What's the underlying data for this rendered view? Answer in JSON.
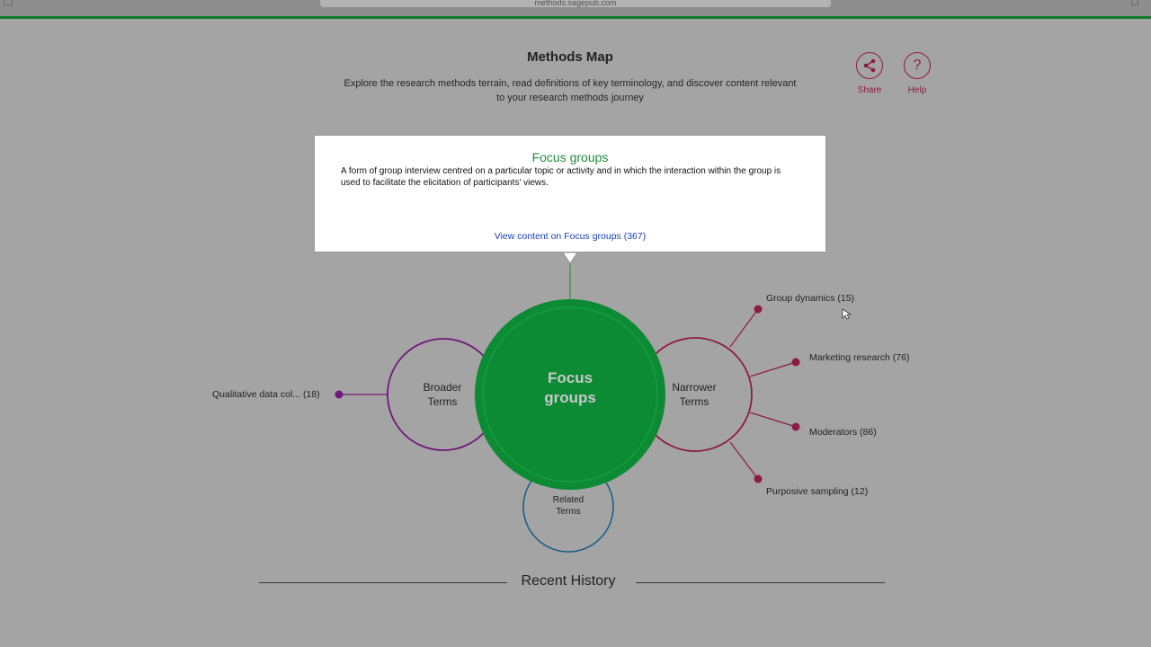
{
  "browser": {
    "url": "methods.sagepub.com"
  },
  "header": {
    "title": "Methods Map",
    "subtitle": "Explore the research methods terrain, read definitions of key terminology, and discover content relevant to your research methods journey",
    "share_label": "Share",
    "help_label": "Help",
    "share_icon": "share-icon",
    "help_icon": "question-mark-icon",
    "help_glyph": "?"
  },
  "definition": {
    "term": "Focus groups",
    "text": "A form of group interview centred on a particular topic or activity and in which the interaction within the group is used to facilitate the elicitation of participants' views.",
    "link": "View content on Focus groups (367)"
  },
  "map": {
    "center_line1": "Focus",
    "center_line2": "groups",
    "broader_line1": "Broader",
    "broader_line2": "Terms",
    "narrower_line1": "Narrower",
    "narrower_line2": "Terms",
    "related_line1": "Related",
    "related_line2": "Terms",
    "broader_terms": [
      "Qualitative data col... (18)"
    ],
    "narrower_terms": [
      "Group dynamics (15)",
      "Marketing research (76)",
      "Moderators (86)",
      "Purposive sampling (12)"
    ]
  },
  "history": {
    "title": "Recent History"
  },
  "colors": {
    "center": "#0c8a34",
    "broader": "#6f1a78",
    "narrower": "#8c1c44",
    "related": "#1f5f86",
    "accent": "#0c7a2c"
  }
}
